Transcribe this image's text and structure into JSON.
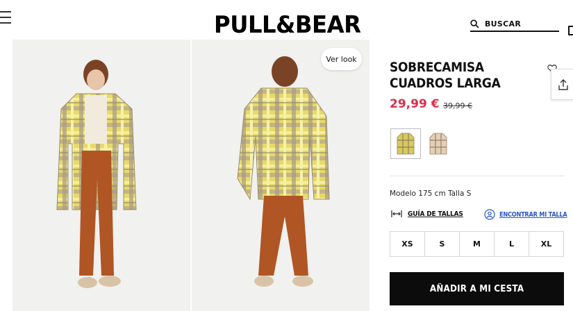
{
  "header": {
    "logo": "PULL&BEAR",
    "search_label": "BUSCAR",
    "menu_icon": "hamburger-menu-icon",
    "bag_icon": "shopping-bag-icon"
  },
  "gallery": {
    "ver_look_label": "Ver look",
    "images": [
      "front-view",
      "back-view"
    ]
  },
  "product": {
    "title_line1": "SOBRECAMISA",
    "title_line2": "CUADROS LARGA",
    "price": "29,99 €",
    "old_price": "39,99 €",
    "colors": [
      "yellow-plaid",
      "beige-plaid"
    ],
    "model_info": "Modelo 175 cm Talla S",
    "size_guide_label": "GUÍA DE TALLAS",
    "find_size_label": "ENCONTRAR MI TALLA",
    "sizes": [
      "XS",
      "S",
      "M",
      "L",
      "XL"
    ],
    "add_to_cart_label": "AÑADIR A MI CESTA"
  },
  "colors": {
    "price": "#d9304b",
    "link": "#2b56c4",
    "button": "#0c0c0c"
  }
}
